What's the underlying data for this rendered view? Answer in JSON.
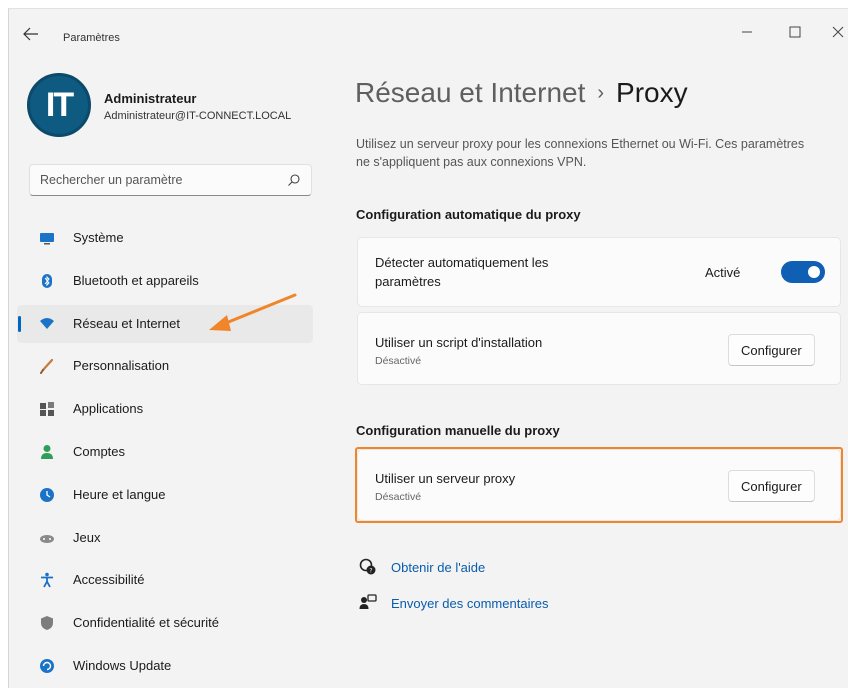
{
  "window": {
    "app_title": "Paramètres",
    "back_icon": "arrow-left-icon",
    "controls": [
      "minimize-icon",
      "maximize-icon",
      "close-icon"
    ]
  },
  "profile": {
    "avatar_text": "IT",
    "name": "Administrateur",
    "email": "Administrateur@IT-CONNECT.LOCAL"
  },
  "search": {
    "placeholder": "Rechercher un paramètre",
    "icon": "search-icon"
  },
  "sidebar": {
    "items": [
      {
        "label": "Système",
        "icon": "monitor-icon",
        "active": false
      },
      {
        "label": "Bluetooth et appareils",
        "icon": "bluetooth-icon",
        "active": false
      },
      {
        "label": "Réseau et Internet",
        "icon": "wifi-icon",
        "active": true
      },
      {
        "label": "Personnalisation",
        "icon": "brush-icon",
        "active": false
      },
      {
        "label": "Applications",
        "icon": "apps-icon",
        "active": false
      },
      {
        "label": "Comptes",
        "icon": "person-icon",
        "active": false
      },
      {
        "label": "Heure et langue",
        "icon": "globe-clock-icon",
        "active": false
      },
      {
        "label": "Jeux",
        "icon": "gamepad-icon",
        "active": false
      },
      {
        "label": "Accessibilité",
        "icon": "accessibility-icon",
        "active": false
      },
      {
        "label": "Confidentialité et sécurité",
        "icon": "shield-icon",
        "active": false
      },
      {
        "label": "Windows Update",
        "icon": "update-icon",
        "active": false
      }
    ]
  },
  "main": {
    "breadcrumb": {
      "parent": "Réseau et Internet",
      "separator": "›",
      "current": "Proxy"
    },
    "description": "Utilisez un serveur proxy pour les connexions Ethernet ou Wi-Fi. Ces paramètres ne s'appliquent pas aux connexions VPN.",
    "auto_section": {
      "title": "Configuration automatique du proxy",
      "detect": {
        "label": "Détecter automatiquement les paramètres",
        "state": "Activé",
        "enabled": true
      },
      "script": {
        "label": "Utiliser un script d'installation",
        "status": "Désactivé",
        "button": "Configurer"
      }
    },
    "manual_section": {
      "title": "Configuration manuelle du proxy",
      "server": {
        "label": "Utiliser un serveur proxy",
        "status": "Désactivé",
        "button": "Configurer"
      }
    },
    "links": {
      "help": "Obtenir de l'aide",
      "feedback": "Envoyer des commentaires"
    }
  },
  "colors": {
    "accent": "#0067c0",
    "toggle_on": "#0f5fb5",
    "annotation_orange": "#f0852a",
    "link": "#0a5cad"
  }
}
